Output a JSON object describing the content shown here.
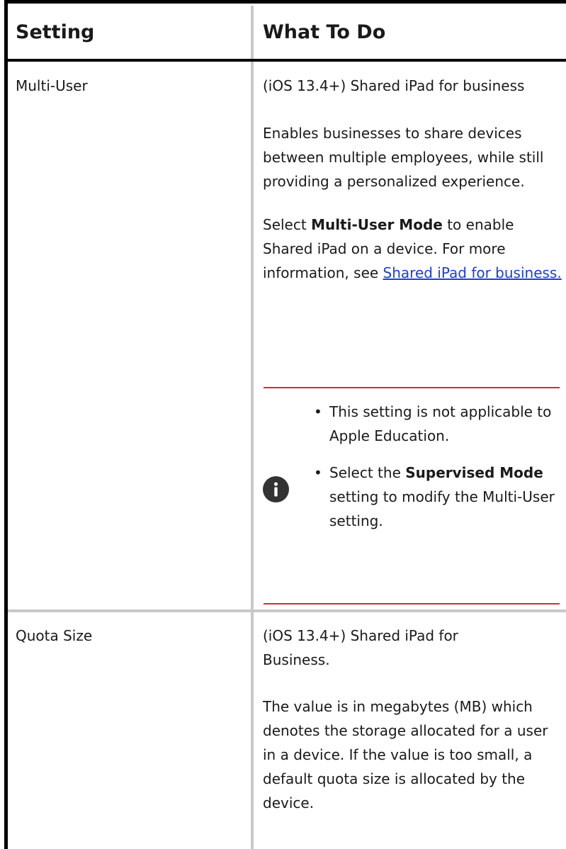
{
  "table": {
    "headers": {
      "setting": "Setting",
      "what_to_do": "What To Do"
    },
    "rows": [
      {
        "setting": "Multi-User",
        "p1": "(iOS 13.4+) Shared iPad for business",
        "p2": "Enables businesses to share devices between multiple employees, while still providing a personalized experience.",
        "p3_pre": "Select ",
        "p3_bold": "Multi-User Mode",
        "p3_mid": " to enable Shared iPad on a device. For more information, see ",
        "p3_link": "Shared iPad for business.",
        "note": {
          "icon": "info-icon",
          "bullet1": "This setting is not applicable to Apple Education.",
          "bullet2_pre": "Select the ",
          "bullet2_bold": "Supervised Mode",
          "bullet2_post": " setting to modify the Multi-User setting."
        }
      },
      {
        "setting": "Quota Size",
        "p1": "(iOS 13.4+) Shared iPad for Business.",
        "p2": "The value is in megabytes (MB) which denotes the storage allocated for a user in a device. If the value is too small, a default quota size is allocated by the device."
      }
    ]
  },
  "colors": {
    "link": "#1a3fd6",
    "note_rule": "#d32f2f",
    "icon_bg": "#333333"
  }
}
